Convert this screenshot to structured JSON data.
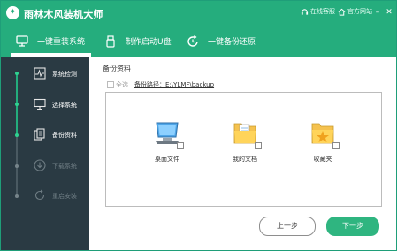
{
  "titlebar": {
    "app_title": "雨林木风装机大师",
    "online_service": "在线客服",
    "official_site": "官方网站"
  },
  "tabs": [
    {
      "label": "一键重装系统",
      "icon": "monitor-icon",
      "active": true
    },
    {
      "label": "制作启动U盘",
      "icon": "usb-drive-icon",
      "active": false
    },
    {
      "label": "一键备份还原",
      "icon": "backup-restore-icon",
      "active": false
    }
  ],
  "steps": [
    {
      "label": "系统检测",
      "icon": "heartbeat-chart-icon",
      "state": "done"
    },
    {
      "label": "选择系统",
      "icon": "monitor-icon",
      "state": "done"
    },
    {
      "label": "备份资料",
      "icon": "copy-files-icon",
      "state": "active"
    },
    {
      "label": "下载系统",
      "icon": "download-icon",
      "state": "pending"
    },
    {
      "label": "重启安装",
      "icon": "restart-icon",
      "state": "pending"
    }
  ],
  "main": {
    "section_title": "备份资料",
    "select_all_label": "全选",
    "backup_path": "备份路径：E:\\YLMF\\backup",
    "items": [
      {
        "label": "桌面文件",
        "icon": "desktop-computer-icon",
        "checked": false
      },
      {
        "label": "我的文档",
        "icon": "documents-folder-icon",
        "checked": false
      },
      {
        "label": "收藏夹",
        "icon": "favorites-folder-icon",
        "checked": false
      }
    ],
    "prev_label": "上一步",
    "next_label": "下一步"
  },
  "colors": {
    "accent": "#25ad7d",
    "sidebar_bg": "#2a3a43",
    "next_button": "#2fb580"
  }
}
